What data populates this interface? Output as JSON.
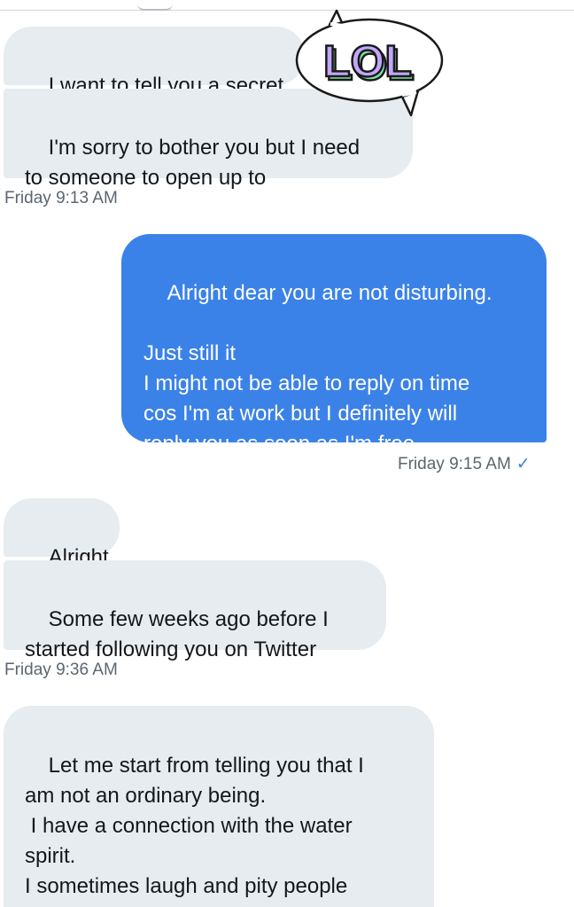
{
  "conversation": {
    "messages": [
      {
        "text": "I want to tell you a secret"
      },
      {
        "text": "I'm sorry to bother you but I need\nto someone to open up to"
      },
      {
        "text": "Alright dear you are not disturbing.\n\nJust still it\nI might not be able to reply on time\ncos I'm at work but I definitely will\nreply you as soon as I'm free"
      },
      {
        "text": "Alright"
      },
      {
        "text": "Some few weeks ago before I\nstarted following you on Twitter"
      },
      {
        "text": "Let me start from telling you that I\nam not an ordinary being.\n I have a connection with the water\nspirit.\nI sometimes laugh and pity people\nwho don't believe in the"
      }
    ],
    "timestamps": [
      {
        "text": "Friday 9:13 AM"
      },
      {
        "text": "Friday 9:15 AM",
        "read_mark": "✓"
      },
      {
        "text": "Friday 9:36 AM"
      }
    ]
  },
  "sticker": {
    "text": "LOL",
    "icon": "speech-bubble-icon",
    "fill_color": "#c2a6ff",
    "shadow_color": "#7ee0a6",
    "outline_color": "#1a1a1a"
  },
  "colors": {
    "incoming_bubble": "#e6ecf0",
    "outgoing_bubble": "#3b82e8",
    "timestamp": "#5b6670"
  }
}
